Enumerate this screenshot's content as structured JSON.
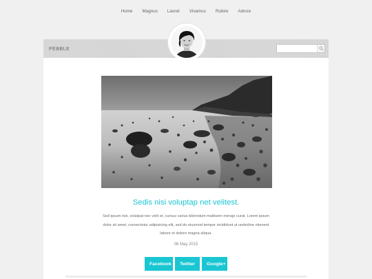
{
  "nav": {
    "items": [
      "Home",
      "Magnus",
      "Laoret",
      "Vivamus",
      "Rubire",
      "Adrore"
    ]
  },
  "header": {
    "brand": "PEBBLE",
    "search_placeholder": "",
    "search_icon": "magnifier-icon"
  },
  "post": {
    "image_alt": "Black and white photo of pebbles on a misty beach",
    "title": "Sedis nisi voluptap net velitest.",
    "excerpt": "Sed ipsum nisi, volutpat nec velit et, cursus varius bibendum mattisem meraje curat. Lorem ipsum dolor sit amet, consectetur adipisicing elit, sed do eiusmod tempor incididunt ut underline element labore et dolore magna aliqua.",
    "date": "06 May 2015"
  },
  "share": {
    "facebook": "Facebook",
    "twitter": "Twitter",
    "google": "Google+"
  },
  "colors": {
    "accent": "#19c6d2",
    "header_bg": "#d4d4d4",
    "page_bg": "#f0f0f0"
  }
}
